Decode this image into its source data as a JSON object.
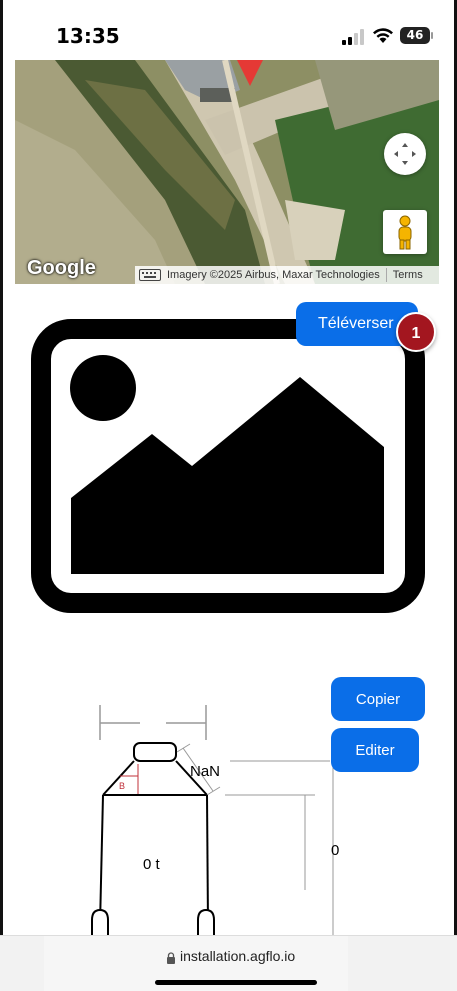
{
  "status_bar": {
    "time": "13:35",
    "battery": "46"
  },
  "map": {
    "logo": "Google",
    "attribution": "Imagery ©2025 Airbus, Maxar Technologies",
    "terms": "Terms",
    "icons": [
      "map-recenter-icon",
      "pegman-icon",
      "keyboard-shortcuts-icon",
      "location-pin-icon"
    ]
  },
  "image_section": {
    "upload_label": "Téléverser",
    "step_number": "1",
    "icon": "image-placeholder-icon"
  },
  "diagram": {
    "nan_label": "NaN",
    "angle_label": "B",
    "weight_label": "0 t",
    "height_label": "0",
    "copy_label": "Copier",
    "edit_label": "Editer"
  },
  "browser": {
    "url": "installation.agflo.io"
  },
  "colors": {
    "primary_button": "#0a6ee8",
    "step_badge": "#a3161f",
    "angle_marker": "#c0303a"
  }
}
